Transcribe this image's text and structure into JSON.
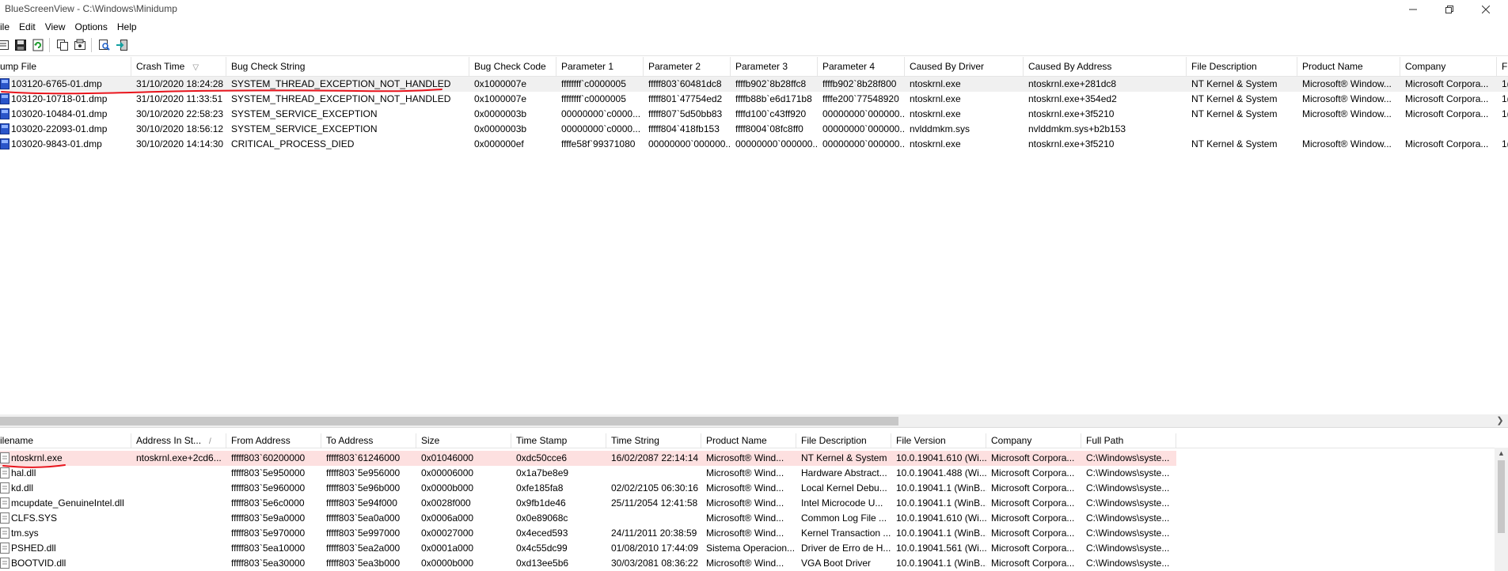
{
  "window": {
    "title": "BlueScreenView  -  C:\\Windows\\Minidump"
  },
  "menu": [
    "ile",
    "Edit",
    "View",
    "Options",
    "Help"
  ],
  "toolbar": [
    "properties-icon",
    "save-icon",
    "refresh-icon",
    "copy-icon",
    "html-report-icon",
    "find-icon",
    "exit-icon"
  ],
  "upper_table": {
    "columns": [
      "ump File",
      "Crash Time",
      "Bug Check String",
      "Bug Check Code",
      "Parameter 1",
      "Parameter 2",
      "Parameter 3",
      "Parameter 4",
      "Caused By Driver",
      "Caused By Address",
      "File Description",
      "Product Name",
      "Company",
      "Fi"
    ],
    "sort_indicator": "▽",
    "rows": [
      [
        "103120-6765-01.dmp",
        "31/10/2020 18:24:28",
        "SYSTEM_THREAD_EXCEPTION_NOT_HANDLED",
        "0x1000007e",
        "ffffffff`c0000005",
        "fffff803`60481dc8",
        "ffffb902`8b28ffc8",
        "ffffb902`8b28f800",
        "ntoskrnl.exe",
        "ntoskrnl.exe+281dc8",
        "NT Kernel & System",
        "Microsoft® Window...",
        "Microsoft Corpora...",
        "1("
      ],
      [
        "103120-10718-01.dmp",
        "31/10/2020 11:33:51",
        "SYSTEM_THREAD_EXCEPTION_NOT_HANDLED",
        "0x1000007e",
        "ffffffff`c0000005",
        "fffff801`47754ed2",
        "ffffb88b`e6d171b8",
        "ffffe200`77548920",
        "ntoskrnl.exe",
        "ntoskrnl.exe+354ed2",
        "NT Kernel & System",
        "Microsoft® Window...",
        "Microsoft Corpora...",
        "1("
      ],
      [
        "103020-10484-01.dmp",
        "30/10/2020 22:58:23",
        "SYSTEM_SERVICE_EXCEPTION",
        "0x0000003b",
        "00000000`c0000...",
        "fffff807`5d50bb83",
        "ffffd100`c43ff920",
        "00000000`000000...",
        "ntoskrnl.exe",
        "ntoskrnl.exe+3f5210",
        "NT Kernel & System",
        "Microsoft® Window...",
        "Microsoft Corpora...",
        "1("
      ],
      [
        "103020-22093-01.dmp",
        "30/10/2020 18:56:12",
        "SYSTEM_SERVICE_EXCEPTION",
        "0x0000003b",
        "00000000`c0000...",
        "fffff804`418fb153",
        "ffff8004`08fc8ff0",
        "00000000`000000...",
        "nvlddmkm.sys",
        "nvlddmkm.sys+b2b153",
        "",
        "",
        "",
        ""
      ],
      [
        "103020-9843-01.dmp",
        "30/10/2020 14:14:30",
        "CRITICAL_PROCESS_DIED",
        "0x000000ef",
        "ffffe58f`99371080",
        "00000000`000000...",
        "00000000`000000...",
        "00000000`000000...",
        "ntoskrnl.exe",
        "ntoskrnl.exe+3f5210",
        "NT Kernel & System",
        "Microsoft® Window...",
        "Microsoft Corpora...",
        "1("
      ]
    ]
  },
  "lower_table": {
    "columns": [
      "ilename",
      "Address In St...",
      "From Address",
      "To Address",
      "Size",
      "Time Stamp",
      "Time String",
      "Product Name",
      "File Description",
      "File Version",
      "Company",
      "Full Path"
    ],
    "sort_indicator": "/",
    "rows": [
      [
        "ntoskrnl.exe",
        "ntoskrnl.exe+2cd6...",
        "fffff803`60200000",
        "fffff803`61246000",
        "0x01046000",
        "0xdc50cce6",
        "16/02/2087 22:14:14",
        "Microsoft® Wind...",
        "NT Kernel & System",
        "10.0.19041.610 (Wi...",
        "Microsoft Corpora...",
        "C:\\Windows\\syste..."
      ],
      [
        "hal.dll",
        "",
        "fffff803`5e950000",
        "fffff803`5e956000",
        "0x00006000",
        "0x1a7be8e9",
        "",
        "Microsoft® Wind...",
        "Hardware Abstract...",
        "10.0.19041.488 (Wi...",
        "Microsoft Corpora...",
        "C:\\Windows\\syste..."
      ],
      [
        "kd.dll",
        "",
        "fffff803`5e960000",
        "fffff803`5e96b000",
        "0x0000b000",
        "0xfe185fa8",
        "02/02/2105 06:30:16",
        "Microsoft® Wind...",
        "Local Kernel Debu...",
        "10.0.19041.1 (WinB...",
        "Microsoft Corpora...",
        "C:\\Windows\\syste..."
      ],
      [
        "mcupdate_GenuineIntel.dll",
        "",
        "fffff803`5e6c0000",
        "fffff803`5e94f000",
        "0x0028f000",
        "0x9fb1de46",
        "25/11/2054 12:41:58",
        "Microsoft® Wind...",
        "Intel Microcode U...",
        "10.0.19041.1 (WinB...",
        "Microsoft Corpora...",
        "C:\\Windows\\syste..."
      ],
      [
        "CLFS.SYS",
        "",
        "fffff803`5e9a0000",
        "fffff803`5ea0a000",
        "0x0006a000",
        "0x0e89068c",
        "",
        "Microsoft® Wind...",
        "Common Log File ...",
        "10.0.19041.610 (Wi...",
        "Microsoft Corpora...",
        "C:\\Windows\\syste..."
      ],
      [
        "tm.sys",
        "",
        "fffff803`5e970000",
        "fffff803`5e997000",
        "0x00027000",
        "0x4eced593",
        "24/11/2011 20:38:59",
        "Microsoft® Wind...",
        "Kernel Transaction ...",
        "10.0.19041.1 (WinB...",
        "Microsoft Corpora...",
        "C:\\Windows\\syste..."
      ],
      [
        "PSHED.dll",
        "",
        "fffff803`5ea10000",
        "fffff803`5ea2a000",
        "0x0001a000",
        "0x4c55dc99",
        "01/08/2010 17:44:09",
        "Sistema Operacion...",
        "Driver de Erro de H...",
        "10.0.19041.561 (Wi...",
        "Microsoft Corpora...",
        "C:\\Windows\\syste..."
      ],
      [
        "BOOTVID.dll",
        "",
        "fffff803`5ea30000",
        "fffff803`5ea3b000",
        "0x0000b000",
        "0xd13ee5b6",
        "30/03/2081 08:36:22",
        "Microsoft® Wind...",
        "VGA Boot Driver",
        "10.0.19041.1 (WinB...",
        "Microsoft Corpora...",
        "C:\\Windows\\syste..."
      ]
    ]
  },
  "colors": {
    "selected_row_upper": "#f0f0f0",
    "selected_row_lower": "#fde0e0",
    "annotation_red": "#e8141c"
  }
}
